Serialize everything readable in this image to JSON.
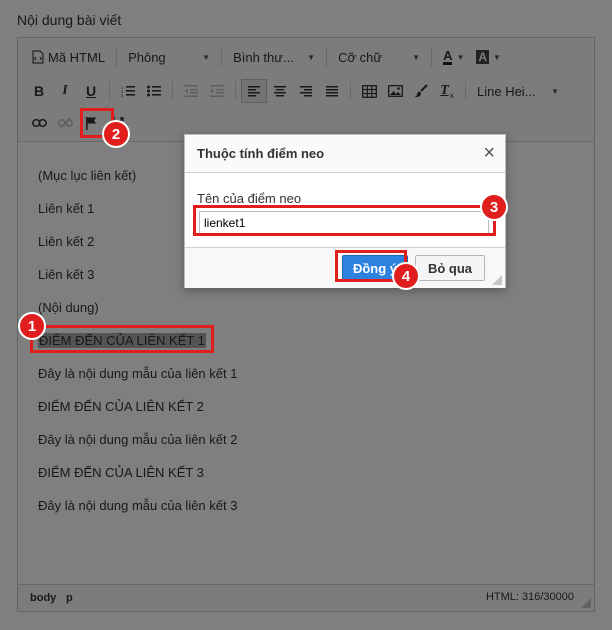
{
  "field_label": "Nội dung bài viết",
  "toolbar": {
    "source_label": "Mã HTML",
    "font_label": "Phông",
    "format_label": "Bình thư...",
    "size_label": "Cỡ chữ",
    "text_color_label": "A",
    "bg_color_label": "A",
    "line_height_label": "Line Hei...",
    "bold_label": "B",
    "italic_label": "I",
    "underline_label": "U",
    "clear_format_label": "T"
  },
  "content": {
    "paragraphs": [
      "(Mục lục liên kết)",
      "Liên kết 1",
      "Liên kết 2",
      "Liên kết 3",
      "(Nội dung)",
      "ĐIỂM ĐẾN CỦA LIÊN KẾT 1",
      "Đây là nội dung mẫu của liên kết 1",
      "ĐIỂM ĐẾN CỦA LIÊN KẾT 2",
      "Đây là nội dung mẫu của liên kết 2",
      "ĐIỂM ĐẾN CỦA LIÊN KẾT 3",
      "Đây là nội dung mẫu của liên kết 3"
    ]
  },
  "statusbar": {
    "path_body": "body",
    "path_p": "p",
    "counter": "HTML: 316/30000"
  },
  "dialog": {
    "title": "Thuộc tính điểm neo",
    "close_icon": "×",
    "field_label": "Tên của điểm neo",
    "field_value": "lienket1",
    "ok_label": "Đồng ý",
    "cancel_label": "Bỏ qua"
  },
  "annotations": {
    "marker_1": "1",
    "marker_2": "2",
    "marker_3": "3",
    "marker_4": "4",
    "color": "#e01e1e"
  },
  "colors": {
    "primary_button": "#2d82df",
    "overlay": "rgba(0,0,0,0.5)"
  }
}
